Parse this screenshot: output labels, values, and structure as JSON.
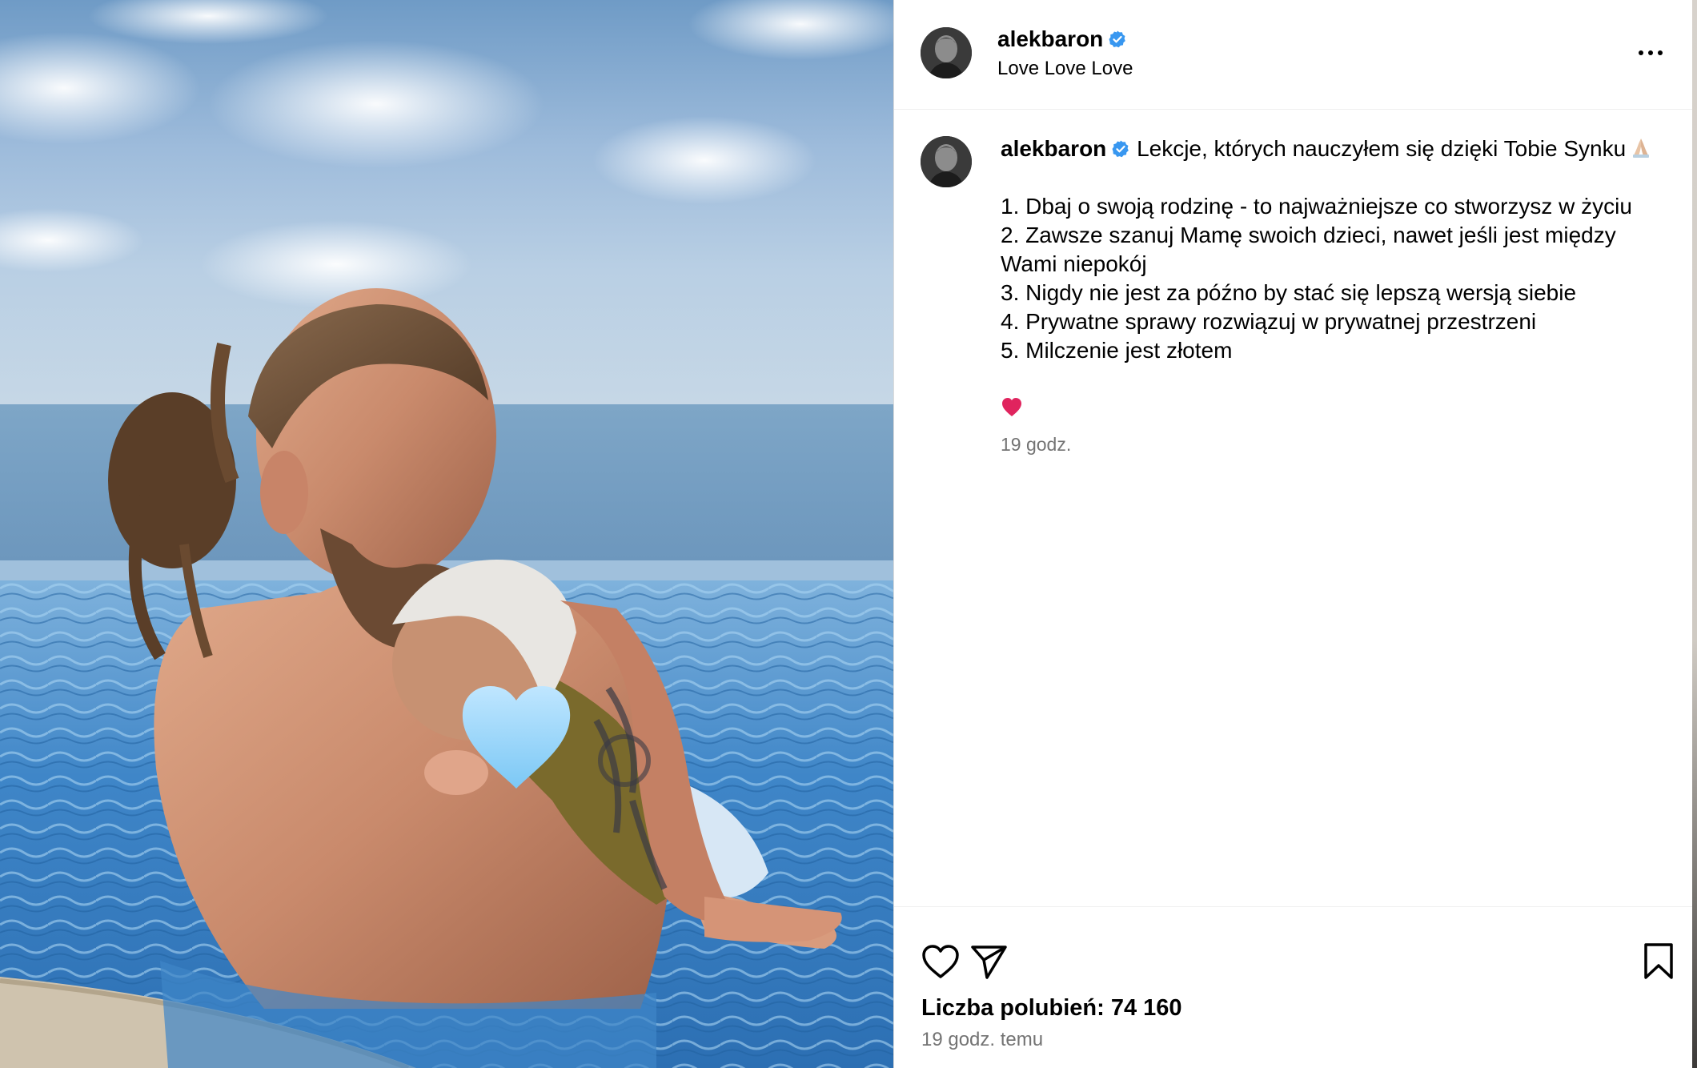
{
  "post": {
    "username": "alekbaron",
    "verified": true,
    "subtitle": "Love Love Love",
    "photo_description_icon": "image-photo"
  },
  "caption": {
    "username": "alekbaron",
    "line_intro": "Lekcje, których nauczyłem się dzięki Tobie Synku",
    "intro_emoji": "folded-hands-emoji",
    "items": [
      "1. Dbaj o swoją rodzinę - to najważniejsze co stworzysz w życiu",
      "2. Zawsze szanuj Mamę swoich dzieci, nawet jeśli jest między Wami niepokój",
      "3. Nigdy nie jest za późno by stać się lepszą wersją siebie",
      "4. Prywatne sprawy rozwiązuj w prywatnej przestrzeni",
      "5. Milczenie jest złotem"
    ],
    "closing_emoji": "red-heart-emoji",
    "time": "19 godz."
  },
  "footer": {
    "likes_label": "Liczba polubień: 74 160",
    "time": "19 godz. temu"
  },
  "icons": {
    "like": "heart-outline-icon",
    "share": "paper-plane-icon",
    "save": "bookmark-icon",
    "more": "more-horizontal-icon",
    "verified": "verified-badge-icon"
  },
  "colors": {
    "verified_blue": "#3897f0",
    "secondary_text": "#737373",
    "heart_red": "#e0245e"
  }
}
